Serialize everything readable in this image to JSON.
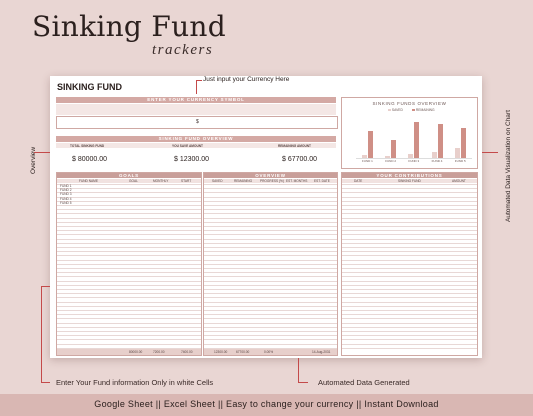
{
  "page": {
    "title": "Sinking Fund",
    "subtitle": "trackers"
  },
  "sheet": {
    "title": "SINKING FUND",
    "currency_band": "ENTER YOUR CURRENCY SYMBOL",
    "currency_value": "$",
    "overview_band": "SINKING FUND OVERVIEW",
    "overview_headers": [
      "TOTAL SINKING FUND",
      "YOU SAVE AMOUNT",
      "REMAINING AMOUNT"
    ],
    "overview_values": [
      "$ 80000.00",
      "$ 12300.00",
      "$ 67700.00"
    ],
    "goals_band": "GOALS",
    "goals_headers": [
      "FUND NAME",
      "GOAL",
      "MONTHLY",
      "START"
    ],
    "goals_total": [
      "80000.00",
      "7200.00",
      "7400.00"
    ],
    "overview2_band": "OVERVIEW",
    "overview2_headers": [
      "SAVED",
      "REMAINING",
      "PROGRESS (%)",
      "EST. MONTHS",
      "EST. DATE"
    ],
    "overview2_total": [
      "12300.00",
      "67700.00",
      "0.00%",
      "",
      "14-Aug-2031"
    ],
    "contrib_band": "YOUR CONTRIBUTIONS",
    "contrib_headers": [
      "DATE",
      "SINKING FUND",
      "AMOUNT"
    ],
    "chart_title": "SINKING FUNDS OVERVIEW",
    "chart_legend": [
      "SAVED",
      "REMAINING"
    ],
    "rows": [
      {
        "name": "FUND 1",
        "goal": "$",
        "saved": "$",
        "remaining": "$"
      },
      {
        "name": "FUND 2",
        "goal": "$",
        "saved": "$",
        "remaining": "$"
      },
      {
        "name": "FUND 3",
        "goal": "$",
        "saved": "$",
        "remaining": "$"
      },
      {
        "name": "FUND 4",
        "goal": "$",
        "saved": "$",
        "remaining": "$"
      },
      {
        "name": "FUND 5",
        "goal": "$",
        "saved": "$",
        "remaining": "$"
      }
    ]
  },
  "chart_data": {
    "type": "bar",
    "title": "SINKING FUNDS OVERVIEW",
    "categories": [
      "FUND 1",
      "FUND 2",
      "FUND 3",
      "FUND 4",
      "FUND 5"
    ],
    "series": [
      {
        "name": "SAVED",
        "values": [
          1500,
          1000,
          2000,
          3000,
          4800
        ]
      },
      {
        "name": "REMAINING",
        "values": [
          13500,
          9000,
          18000,
          17000,
          15200
        ]
      }
    ]
  },
  "callouts": {
    "currency": "Just input your Currency Here",
    "overview": "Overview",
    "chart": "Automated Data Visualization on Chart",
    "fund_info": "Enter Your Fund information Only  in white Cells",
    "automated": "Automated Data Generated"
  },
  "footer": "Google Sheet   ||  Excel Sheet  ||  Easy to change your currency   ||   Instant Download",
  "colors": {
    "accent": "#c44a4a",
    "band": "#d4a9a4",
    "background": "#e9d6d3"
  }
}
